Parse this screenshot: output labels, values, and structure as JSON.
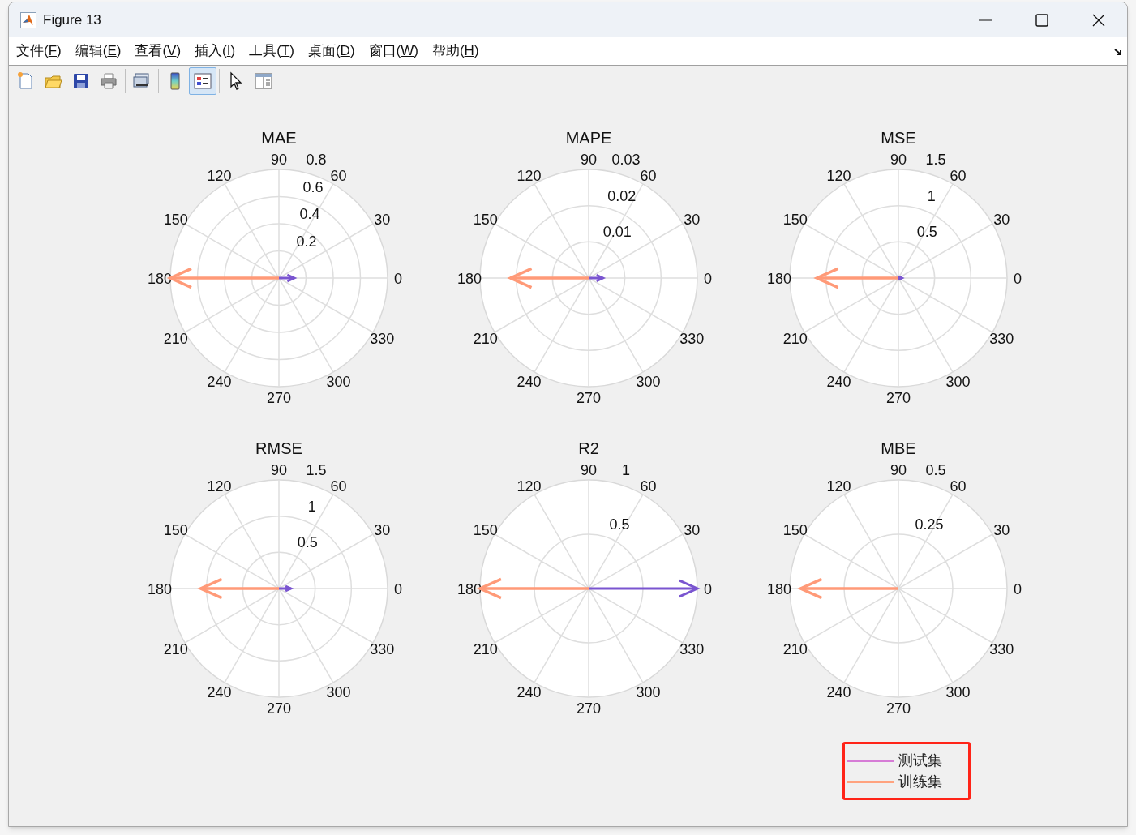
{
  "window": {
    "title": "Figure 13"
  },
  "menu": [
    "文件(F)",
    "编辑(E)",
    "查看(V)",
    "插入(I)",
    "工具(T)",
    "桌面(D)",
    "窗口(W)",
    "帮助(H)"
  ],
  "toolbar": [
    {
      "kind": "new",
      "selected": false
    },
    {
      "kind": "open",
      "selected": false
    },
    {
      "kind": "save",
      "selected": false
    },
    {
      "kind": "print",
      "selected": false
    },
    {
      "kind": "link",
      "selected": false
    },
    {
      "kind": "colorbar",
      "selected": false
    },
    {
      "kind": "legend",
      "selected": true
    },
    {
      "kind": "pointer",
      "selected": false
    },
    {
      "kind": "panel",
      "selected": false
    }
  ],
  "plots": [
    {
      "title": "MAE",
      "radial_ticks": [
        "0.8",
        "0.6",
        "0.4",
        "0.2"
      ],
      "angle_labels": [
        "0",
        "30",
        "60",
        "90",
        "120",
        "150",
        "180",
        "210",
        "240",
        "270",
        "300",
        "330"
      ],
      "vectors": [
        {
          "kind": "rightward",
          "color": "#7a55d0",
          "level": 0.14
        },
        {
          "kind": "leftward",
          "color": "#ff9a78",
          "level": 1.0
        }
      ]
    },
    {
      "title": "MAPE",
      "radial_ticks": [
        "0.03",
        "0.02",
        "0.01"
      ],
      "angle_labels": [
        "0",
        "30",
        "60",
        "90",
        "120",
        "150",
        "180",
        "210",
        "240",
        "270",
        "300",
        "330"
      ],
      "vectors": [
        {
          "kind": "rightward",
          "color": "#7a55d0",
          "level": 0.13
        },
        {
          "kind": "leftward",
          "color": "#ff9a78",
          "level": 0.72
        }
      ]
    },
    {
      "title": "MSE",
      "radial_ticks": [
        "1.5",
        "1",
        "0.5"
      ],
      "angle_labels": [
        "0",
        "30",
        "60",
        "90",
        "120",
        "150",
        "180",
        "210",
        "240",
        "270",
        "300",
        "330"
      ],
      "vectors": [
        {
          "kind": "rightward",
          "color": "#7a55d0",
          "level": 0.03
        },
        {
          "kind": "leftward",
          "color": "#ff9a78",
          "level": 0.75
        }
      ]
    },
    {
      "title": "RMSE",
      "radial_ticks": [
        "1.5",
        "1",
        "0.5"
      ],
      "angle_labels": [
        "0",
        "30",
        "60",
        "90",
        "120",
        "150",
        "180",
        "210",
        "240",
        "270",
        "300",
        "330"
      ],
      "vectors": [
        {
          "kind": "rightward",
          "color": "#7a55d0",
          "level": 0.11
        },
        {
          "kind": "leftward",
          "color": "#ff9a78",
          "level": 0.72
        }
      ]
    },
    {
      "title": "R2",
      "radial_ticks": [
        "1",
        "0.5"
      ],
      "angle_labels": [
        "0",
        "30",
        "60",
        "90",
        "120",
        "150",
        "180",
        "210",
        "240",
        "270",
        "300",
        "330"
      ],
      "vectors": [
        {
          "kind": "rightward",
          "color": "#7a55d0",
          "level": 1.0
        },
        {
          "kind": "leftward",
          "color": "#ff9a78",
          "level": 1.0
        }
      ]
    },
    {
      "title": "MBE",
      "radial_ticks": [
        "0.5",
        "0.25"
      ],
      "angle_labels": [
        "0",
        "30",
        "60",
        "90",
        "120",
        "150",
        "180",
        "210",
        "240",
        "270",
        "300",
        "330"
      ],
      "vectors": [
        {
          "kind": "leftward",
          "color": "#ff9a78",
          "level": 0.9
        }
      ]
    }
  ],
  "legend": {
    "items": [
      {
        "label": "测试集",
        "color": "#d67cd6"
      },
      {
        "label": "训练集",
        "color": "#ffa37f"
      }
    ]
  }
}
